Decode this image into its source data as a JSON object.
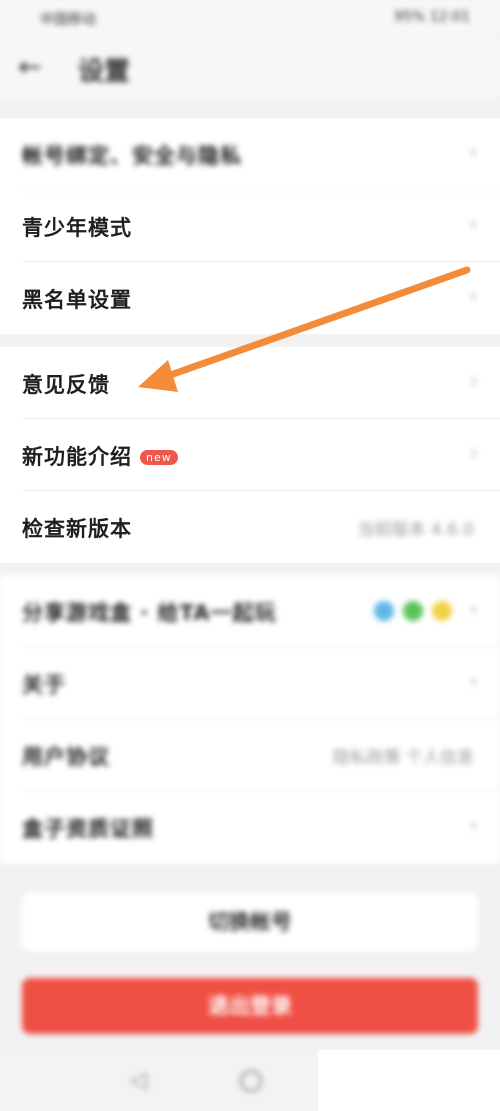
{
  "status_bar": {
    "left": "中国移动",
    "right": "95% 12:01"
  },
  "header": {
    "title": "设置",
    "back_glyph": "←"
  },
  "group1": [
    {
      "label": "帐号绑定、安全与隐私"
    },
    {
      "label": "青少年模式"
    },
    {
      "label": "黑名单设置"
    }
  ],
  "group2": [
    {
      "label": "意见反馈"
    },
    {
      "label": "新功能介绍",
      "badge": "new"
    },
    {
      "label": "检查新版本",
      "value": "当前版本 4.6.0"
    }
  ],
  "group3": [
    {
      "label": "分享游戏盒 · 给TA一起玩"
    },
    {
      "label": "关于"
    },
    {
      "label": "用户协议",
      "value": "隐私政策 个人信息"
    },
    {
      "label": "盒子资质证照"
    }
  ],
  "buttons": {
    "logout": "切换帐号",
    "exit": "退出登录"
  },
  "share_colors": [
    "#5fb7e8",
    "#5ac25a",
    "#f2d14a"
  ],
  "annotation_color": "#f28c3a",
  "chevron": "›"
}
